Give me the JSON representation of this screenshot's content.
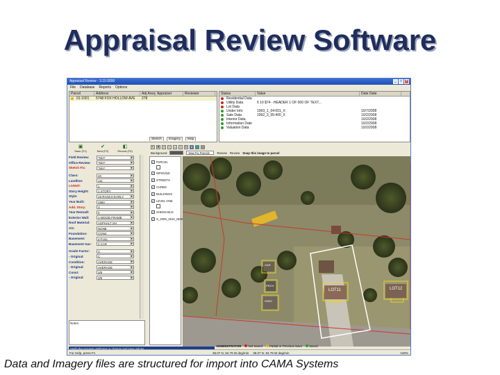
{
  "slide": {
    "title": "Appraisal Review Software",
    "caption": "Data and Imagery files are structured for import into CAMA Systems"
  },
  "window": {
    "title": "Appraisal Review - 3.10.0000",
    "menu": [
      "File",
      "Database",
      "Reports",
      "Options"
    ]
  },
  "parcel_grid": {
    "headers": [
      "Parcel",
      "Address",
      "Adj Area",
      "Appraiser",
      "Reviewer"
    ],
    "rows": [
      [
        "01-1001",
        "5748 FOX HOLLOW AVE",
        "278",
        "",
        ""
      ]
    ]
  },
  "status_grid": {
    "headers": [
      "Status",
      "Value",
      "Date Date"
    ],
    "rows": [
      {
        "status": "Residential Data",
        "value": "",
        "date": "",
        "color": "#c9261f"
      },
      {
        "status": "Utility Data",
        "value": "5 10 $74 - HEADER 1 OF 000 OF TEXT...",
        "date": "",
        "color": "#c9261f"
      },
      {
        "status": "Lot Data",
        "value": "",
        "date": "",
        "color": "#c9261f"
      },
      {
        "status": "Under Info",
        "value": "1993_1_04:001_X",
        "date": "10/7/2008",
        "color": "#2d9b2d"
      },
      {
        "status": "Sale Data",
        "value": "1992_3_05:400_X",
        "date": "10/2/2008",
        "color": "#2d9b2d"
      },
      {
        "status": "Interior Data",
        "value": "",
        "date": "10/2/2008",
        "color": "#2d9b2d"
      },
      {
        "status": "Information Date",
        "value": "",
        "date": "10/2/2008",
        "color": "#2d9b2d"
      },
      {
        "status": "Valuation Data",
        "value": "",
        "date": "10/2/2008",
        "color": "#2d9b2d"
      }
    ]
  },
  "left_tools": [
    {
      "icon": "save-icon",
      "glyph": "▣",
      "label": "Save (F1)"
    },
    {
      "icon": "check-icon",
      "glyph": "✔",
      "label": "Next (F2)"
    },
    {
      "icon": "record-icon",
      "glyph": "◧",
      "label": "Record (F4)"
    }
  ],
  "form": {
    "fields": [
      {
        "label": "Field Review:",
        "value": "*N/A*",
        "required": false
      },
      {
        "label": "Office Review:",
        "value": "*N/A*",
        "required": false
      },
      {
        "label": "Sketch Fix:",
        "value": "*N/A*",
        "required": true
      },
      {
        "label": "Class:",
        "value": "40",
        "required": false,
        "gap": true
      },
      {
        "label": "Landline:",
        "value": "111",
        "required": false
      },
      {
        "label": "LIVINIT:",
        "value": "1",
        "required": true
      },
      {
        "label": "Story Height:",
        "value": "1 STORY",
        "required": false
      },
      {
        "label": "Style:",
        "value": "15-RANCH EARLY",
        "required": false
      },
      {
        "label": "Year Built:",
        "value": "1960",
        "required": false
      },
      {
        "label": "Add. Story:",
        "value": "X",
        "required": true
      },
      {
        "label": "Year Remodl:",
        "value": "0",
        "required": false
      },
      {
        "label": "Exterior Wall:",
        "value": "1-WOOD FRAME",
        "required": false
      },
      {
        "label": "Roof Material:",
        "value": "ASPHALT SH",
        "required": false
      },
      {
        "label": "A/c:",
        "value": "NONE",
        "required": false
      },
      {
        "label": "Foundation:",
        "value": "CONC",
        "required": false
      },
      {
        "label": "Basement:",
        "value": "4-FULL",
        "required": false
      },
      {
        "label": "Basement Gar:",
        "value": "2 CAR",
        "required": false
      },
      {
        "label": "Grade Factor:",
        "value": "C",
        "required": false,
        "gap": true
      },
      {
        "label": "- Original:",
        "value": "C",
        "required": false
      },
      {
        "label": "Condition:",
        "value": "AVERAGE",
        "required": false
      },
      {
        "label": "- Original:",
        "value": "AVERAGE",
        "required": false
      },
      {
        "label": "Const:",
        "value": "3/8",
        "required": false
      },
      {
        "label": "- Original:",
        "value": "3/8",
        "required": false
      }
    ],
    "notes_label": "Notes:"
  },
  "hint": "Verify the property attributes or change and save values",
  "right": {
    "tabs": [
      "Sketch",
      "Imagery",
      "Map"
    ],
    "background_label": "Background",
    "combo_value": "New Fix Parcels",
    "review_label": "Review",
    "review2_label": "Review",
    "snap_label": "Snap this image to parcel",
    "layers": [
      {
        "name": "PARCEL",
        "checked": true
      },
      {
        "name": "WPOUND",
        "checked": true
      },
      {
        "name": "STREETS",
        "checked": true
      },
      {
        "name": "CURBS",
        "checked": true
      },
      {
        "name": "BUILDINGS",
        "checked": true
      },
      {
        "name": "LEVEL ONE",
        "checked": true
      },
      {
        "name": "SHEDS-BLD",
        "checked": true
      },
      {
        "name": "S_2009_2010_NEW",
        "checked": true
      }
    ]
  },
  "map_labels": {
    "lot_main": "LOT11",
    "lot_right": "LOT12",
    "garage": "GAR",
    "porch": "PRCH",
    "shed": "SHED"
  },
  "admin_bar": {
    "user": "ADMINISTRATOR",
    "legend": [
      {
        "label": "Not Saved",
        "color": "#c9261f"
      },
      {
        "label": "Partial or Previous Save",
        "color": "#e0b21b"
      },
      {
        "label": "Saved",
        "color": "#2d9b2d"
      }
    ]
  },
  "statusbar": {
    "left": "For Help, press F1",
    "coord1": "39.07 N, 94.79 W deg/min",
    "coord2": "39.07 N, 94.79 W deg/min",
    "zoom": "100%"
  }
}
